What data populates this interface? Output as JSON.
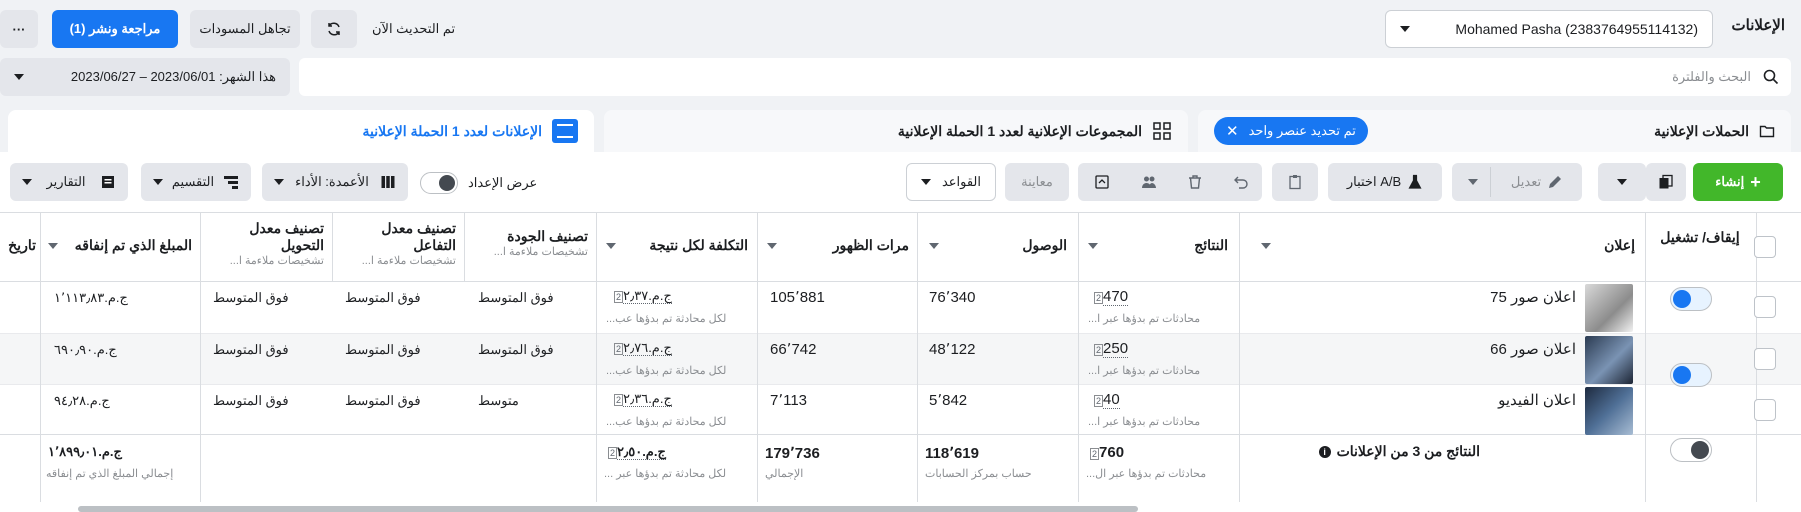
{
  "header": {
    "title": "الإعلانات",
    "account": "Mohamed Pasha (2383764955114132)",
    "updated": "تم التحديث الآن",
    "discard": "تجاهل المسودات",
    "review": "مراجعة ونشر (1)",
    "more": "···"
  },
  "search": {
    "placeholder": "البحث والفلترة"
  },
  "date_range": "هذا الشهر: 2023/06/01 – 2023/06/27",
  "tabs": {
    "campaigns": "الحملات الإعلانية",
    "selected_chip": "تم تحديد عنصر واحد",
    "adsets": "المجموعات الإعلانية لعدد 1 الحملة الإعلانية",
    "ads": "الإعلانات لعدد 1 الحملة الإعلانية"
  },
  "toolbar": {
    "create": "إنشاء",
    "edit": "تعديل",
    "ab_test": "اختبار A/B",
    "preview": "معاينة",
    "rules": "القواعد",
    "show_setup": "عرض الإعداد",
    "columns": "الأعمدة: الأداء",
    "breakdown": "التقسيم",
    "reports": "التقارير"
  },
  "columns": {
    "onoff": "إيقاف/ تشغيل",
    "ad": "إعلان",
    "results": "النتائج",
    "reach": "الوصول",
    "impressions": "مرات الظهور",
    "cost": "التكلفة لكل نتيجة",
    "quality": "تصنيف الجودة",
    "quality_sub": "تشخيصات ملاءمة ا...",
    "engagement": "تصنيف معدل التفاعل",
    "engagement_sub": "تشخيصات ملاءمة ا...",
    "conversion": "تصنيف معدل التحويل",
    "conversion_sub": "تشخيصات ملاءمة ا...",
    "spent": "المبلغ الذي تم إنفاقه",
    "date": "تاريخ"
  },
  "rows": [
    {
      "name": "اعلان صور 75",
      "on": true,
      "results": "470",
      "results_sub": "محادثات تم بدؤها عبر ا...",
      "reach": "76٬340",
      "impressions": "105٬881",
      "cost": "ج.م.٢٫٣٧",
      "cost_sub": "لكل محادثة تم بدؤها عب...",
      "quality": "فوق المتوسط",
      "engagement": "فوق المتوسط",
      "conversion": "فوق المتوسط",
      "spent": "ج.م.١٬١١٣٫٨٣"
    },
    {
      "name": "اعلان صور 66",
      "on": true,
      "results": "250",
      "results_sub": "محادثات تم بدؤها عبر ا...",
      "reach": "48٬122",
      "impressions": "66٬742",
      "cost": "ج.م.٢٫٧٦",
      "cost_sub": "لكل محادثة تم بدؤها عب...",
      "quality": "فوق المتوسط",
      "engagement": "فوق المتوسط",
      "conversion": "فوق المتوسط",
      "spent": "ج.م.٦٩٠٫٩٠"
    },
    {
      "name": "اعلان الفيديو",
      "on": false,
      "results": "40",
      "results_sub": "محادثات تم بدؤها عبر ا...",
      "reach": "5٬842",
      "impressions": "7٬113",
      "cost": "ج.م.٢٫٣٦",
      "cost_sub": "لكل محادثة تم بدؤها عب...",
      "quality": "متوسط",
      "engagement": "فوق المتوسط",
      "conversion": "فوق المتوسط",
      "spent": "ج.م.٩٤٫٢٨"
    }
  ],
  "totals": {
    "label": "النتائج من 3 من الإعلانات",
    "results": "760",
    "results_sub": "محادثات تم بدؤها عبر ال...",
    "reach": "118٬619",
    "reach_sub": "حساب بمركز الحسابات",
    "impressions": "179٬736",
    "impressions_sub": "الإجمالي",
    "cost": "ج.م.٢٫٥٠",
    "cost_sub": "لكل محادثة تم بدؤها عبر ...",
    "spent": "ج.م.١٬٨٩٩٫٠١",
    "spent_sub": "إجمالي المبلغ الذي تم إنفاقه"
  },
  "colors": {
    "primary": "#1877f2",
    "create": "#42b72a"
  }
}
